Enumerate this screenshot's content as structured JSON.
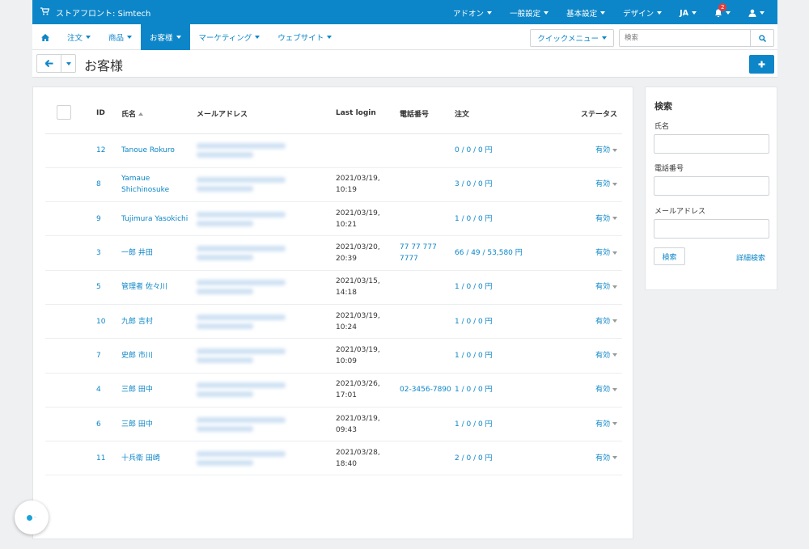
{
  "topbar": {
    "brand": "ストアフロント: Simtech",
    "menu": [
      {
        "label": "アドオン"
      },
      {
        "label": "一般設定"
      },
      {
        "label": "基本設定"
      },
      {
        "label": "デザイン"
      },
      {
        "label": "JA"
      }
    ],
    "notification_count": "2"
  },
  "nav": {
    "items": [
      {
        "label": "注文"
      },
      {
        "label": "商品"
      },
      {
        "label": "お客様"
      },
      {
        "label": "マーケティング"
      },
      {
        "label": "ウェブサイト"
      }
    ],
    "quick_menu": "クイックメニュー",
    "search_placeholder": "検索"
  },
  "page": {
    "title": "お客様"
  },
  "table": {
    "headers": {
      "id": "ID",
      "name": "氏名",
      "email": "メールアドレス",
      "last_login": "Last login",
      "phone": "電話番号",
      "orders": "注文",
      "status": "ステータス"
    },
    "rows": [
      {
        "id": "12",
        "name": "Tanoue Rokuro",
        "login_date": "",
        "login_time": "",
        "phone": "",
        "orders": "0 / 0 / 0 円",
        "status": "有効"
      },
      {
        "id": "8",
        "name": "Yamaue Shichinosuke",
        "login_date": "2021/03/19,",
        "login_time": "10:19",
        "phone": "",
        "orders": "3 / 0 / 0 円",
        "status": "有効"
      },
      {
        "id": "9",
        "name": "Tujimura Yasokichi",
        "login_date": "2021/03/19,",
        "login_time": "10:21",
        "phone": "",
        "orders": "1 / 0 / 0 円",
        "status": "有効"
      },
      {
        "id": "3",
        "name": "一郎 井田",
        "login_date": "2021/03/20,",
        "login_time": "20:39",
        "phone": "77 77 777 7777",
        "orders": "66 / 49 / 53,580 円",
        "status": "有効"
      },
      {
        "id": "5",
        "name": "管理者 佐々川",
        "login_date": "2021/03/15,",
        "login_time": "14:18",
        "phone": "",
        "orders": "1 / 0 / 0 円",
        "status": "有効"
      },
      {
        "id": "10",
        "name": "九郎 吉村",
        "login_date": "2021/03/19,",
        "login_time": "10:24",
        "phone": "",
        "orders": "1 / 0 / 0 円",
        "status": "有効"
      },
      {
        "id": "7",
        "name": "史郎 市川",
        "login_date": "2021/03/19,",
        "login_time": "10:09",
        "phone": "",
        "orders": "1 / 0 / 0 円",
        "status": "有効"
      },
      {
        "id": "4",
        "name": "三郎 田中",
        "login_date": "2021/03/26,",
        "login_time": "17:01",
        "phone": "02-3456-7890",
        "orders": "1 / 0 / 0 円",
        "status": "有効"
      },
      {
        "id": "6",
        "name": "三郎 田中",
        "login_date": "2021/03/19,",
        "login_time": "09:43",
        "phone": "",
        "orders": "1 / 0 / 0 円",
        "status": "有効"
      },
      {
        "id": "11",
        "name": "十兵衛 田崎",
        "login_date": "2021/03/28,",
        "login_time": "18:40",
        "phone": "",
        "orders": "2 / 0 / 0 円",
        "status": "有効"
      }
    ]
  },
  "sidebar": {
    "title": "検索",
    "name_label": "氏名",
    "phone_label": "電話番号",
    "email_label": "メールアドレス",
    "search_button": "検索",
    "advanced_link": "詳細検索"
  },
  "colors": {
    "accent": "#0c86c8",
    "background": "#eef0f2"
  }
}
